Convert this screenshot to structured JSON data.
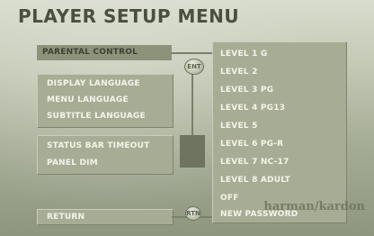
{
  "title": "PLAYER SETUP MENU",
  "left_menu": {
    "selected": "PARENTAL CONTROL",
    "group1": [
      "DISPLAY LANGUAGE",
      "MENU LANGUAGE",
      "SUBTITLE LANGUAGE"
    ],
    "group2": [
      "STATUS BAR TIMEOUT",
      "PANEL DIM"
    ],
    "return_label": "RETURN"
  },
  "buttons": {
    "enter_label": "ENT",
    "return_icon_label": "RTN"
  },
  "submenu": {
    "items": [
      {
        "label": "LEVEL 1 G"
      },
      {
        "label": "LEVEL 2"
      },
      {
        "label": "LEVEL 3 PG"
      },
      {
        "label": "LEVEL 4 PG13"
      },
      {
        "label": "LEVEL 5"
      },
      {
        "label": "LEVEL 6 PG-R"
      },
      {
        "label": "LEVEL 7 NC-17"
      },
      {
        "label": "LEVEL 8 ADULT"
      },
      {
        "label": "OFF"
      },
      {
        "label": "NEW PASSWORD"
      }
    ]
  },
  "brand": "harman/kardon",
  "colors": {
    "background": "#c6cbb8",
    "panel": "#a7ad95",
    "selected": "#8d927a",
    "text": "#f4f4ea",
    "title": "#4a4f3e"
  }
}
